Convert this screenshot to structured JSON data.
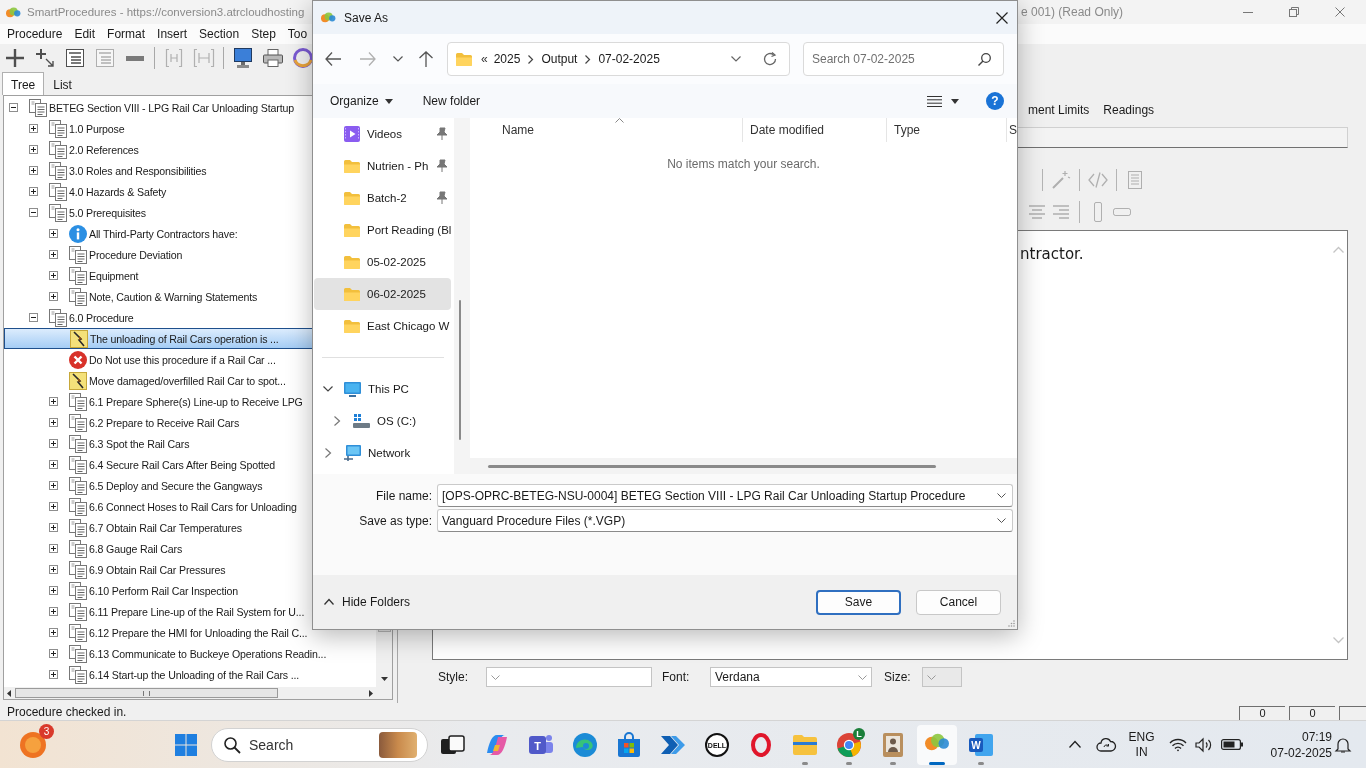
{
  "app_window": {
    "title": "SmartProcedures - https://conversion3.atrcloudhosting",
    "title_tail": "e 001) (Read Only)"
  },
  "menu": [
    "Procedure",
    "Edit",
    "Format",
    "Insert",
    "Section",
    "Step",
    "Too"
  ],
  "toolbar": [
    {
      "kind": "add",
      "disabled": false
    },
    {
      "kind": "add-child",
      "disabled": false
    },
    {
      "kind": "list",
      "disabled": false
    },
    {
      "kind": "list",
      "disabled": true
    },
    {
      "kind": "remove",
      "disabled": false
    },
    {
      "kind": "separator"
    },
    {
      "kind": "bracket",
      "disabled": true
    },
    {
      "kind": "bracket-wide",
      "disabled": true
    },
    {
      "kind": "separator"
    },
    {
      "kind": "monitor",
      "disabled": false
    },
    {
      "kind": "printer",
      "disabled": false
    },
    {
      "kind": "ring",
      "disabled": false
    }
  ],
  "tree": {
    "tabs": [
      {
        "label": "Tree",
        "selected": true
      },
      {
        "label": "List",
        "selected": false
      }
    ],
    "nodes": [
      {
        "label": "BETEG Section VIII - LPG Rail Car Unloading Startup",
        "kind": "section",
        "expanded": true,
        "selected": false,
        "children": [
          {
            "label": "1.0 Purpose",
            "kind": "section",
            "expanded": false,
            "selected": false
          },
          {
            "label": "2.0 References",
            "kind": "section",
            "expanded": false,
            "selected": false
          },
          {
            "label": "3.0 Roles and Responsibilities",
            "kind": "section",
            "expanded": false,
            "selected": false
          },
          {
            "label": "4.0 Hazards & Safety",
            "kind": "section",
            "expanded": false,
            "selected": false
          },
          {
            "label": "5.0 Prerequisites",
            "kind": "section",
            "expanded": true,
            "selected": false,
            "children": [
              {
                "label": "All Third-Party Contractors have:",
                "kind": "info",
                "expanded": false,
                "selected": false
              },
              {
                "label": "Procedure Deviation",
                "kind": "section",
                "expanded": false,
                "selected": false
              },
              {
                "label": "Equipment",
                "kind": "section",
                "expanded": false,
                "selected": false
              },
              {
                "label": "Note, Caution & Warning Statements",
                "kind": "section",
                "expanded": false,
                "selected": false
              }
            ]
          },
          {
            "label": "6.0 Procedure",
            "kind": "section",
            "expanded": true,
            "selected": false,
            "children": [
              {
                "label": "The unloading of Rail Cars operation is ...",
                "kind": "note",
                "selected": true
              },
              {
                "label": "Do Not use this procedure if a Rail Car ...",
                "kind": "stop",
                "selected": false
              },
              {
                "label": "Move damaged/overfilled Rail Car to spot...",
                "kind": "note",
                "selected": false
              },
              {
                "label": "6.1 Prepare Sphere(s) Line-up to Receive LPG",
                "kind": "section",
                "expanded": false,
                "selected": false
              },
              {
                "label": "6.2 Prepare to Receive Rail Cars",
                "kind": "section",
                "expanded": false,
                "selected": false
              },
              {
                "label": "6.3 Spot the Rail Cars",
                "kind": "section",
                "expanded": false,
                "selected": false
              },
              {
                "label": "6.4 Secure Rail Cars After Being Spotted",
                "kind": "section",
                "expanded": false,
                "selected": false
              },
              {
                "label": "6.5 Deploy and Secure the Gangways",
                "kind": "section",
                "expanded": false,
                "selected": false
              },
              {
                "label": "6.6 Connect Hoses to Rail Cars for Unloading",
                "kind": "section",
                "expanded": false,
                "selected": false
              },
              {
                "label": "6.7 Obtain Rail Car Temperatures",
                "kind": "section",
                "expanded": false,
                "selected": false
              },
              {
                "label": "6.8 Gauge Rail Cars",
                "kind": "section",
                "expanded": false,
                "selected": false
              },
              {
                "label": "6.9 Obtain Rail Car Pressures",
                "kind": "section",
                "expanded": false,
                "selected": false
              },
              {
                "label": "6.10 Perform Rail Car Inspection",
                "kind": "section",
                "expanded": false,
                "selected": false
              },
              {
                "label": "6.11 Prepare Line-up of the Rail System for U...",
                "kind": "section",
                "expanded": false,
                "selected": false
              },
              {
                "label": "6.12 Prepare the HMI for Unloading the Rail C...",
                "kind": "section",
                "expanded": false,
                "selected": false
              },
              {
                "label": "6.13 Communicate to Buckeye Operations Readin...",
                "kind": "section",
                "expanded": false,
                "selected": false
              },
              {
                "label": "6.14 Start-up the Unloading of the Rail Cars ...",
                "kind": "section",
                "expanded": false,
                "selected": false
              }
            ]
          }
        ]
      }
    ]
  },
  "detail": {
    "tabs": [
      {
        "label": "ment Limits",
        "selected": false
      },
      {
        "label": "Readings",
        "selected": false
      }
    ],
    "toolbar": [
      [
        {
          "kind": "separator"
        },
        {
          "kind": "wand",
          "disabled": true
        },
        {
          "kind": "separator"
        },
        {
          "kind": "code",
          "disabled": true
        },
        {
          "kind": "separator"
        },
        {
          "kind": "page",
          "disabled": true
        }
      ],
      [
        {
          "kind": "align-center",
          "disabled": true
        },
        {
          "kind": "align-right",
          "disabled": true
        },
        {
          "kind": "separator"
        },
        {
          "kind": "column",
          "disabled": true
        },
        {
          "kind": "field",
          "disabled": true
        }
      ]
    ],
    "editor_text": "ntractor.",
    "format_bar": [
      {
        "label": "Style:",
        "disabled": false
      },
      {
        "label": "Font:",
        "value": "Verdana",
        "disabled": false
      },
      {
        "label": "Size:",
        "disabled": true
      }
    ]
  },
  "status_bar": {
    "text": "Procedure checked in.",
    "panels": [
      "0",
      "0"
    ]
  },
  "dialog": {
    "title": "Save As",
    "nav_buttons": [
      {
        "kind": "back",
        "disabled": false
      },
      {
        "kind": "forward",
        "disabled": true
      },
      {
        "kind": "recent",
        "disabled": false
      },
      {
        "kind": "up",
        "disabled": false
      }
    ],
    "address": {
      "overflow": "«",
      "segments": [
        "2025",
        "Output",
        "07-02-2025"
      ]
    },
    "search": {
      "placeholder": "Search 07-02-2025"
    },
    "commands": [
      {
        "label": "Organize",
        "kind": "menu"
      },
      {
        "label": "New folder",
        "kind": "button"
      }
    ],
    "help": "?",
    "nav": {
      "quick_access": [
        {
          "label": "Videos",
          "kind": "videos",
          "pinned": true,
          "selected": false
        },
        {
          "label": "Nutrien - Ph",
          "kind": "folder",
          "pinned": true,
          "selected": false
        },
        {
          "label": "Batch-2",
          "kind": "folder",
          "pinned": true,
          "selected": false
        },
        {
          "label": "Port Reading (Bl",
          "kind": "folder",
          "pinned": false,
          "selected": false
        },
        {
          "label": "05-02-2025",
          "kind": "folder",
          "pinned": false,
          "selected": false
        },
        {
          "label": "06-02-2025",
          "kind": "folder",
          "pinned": false,
          "selected": true
        },
        {
          "label": "East Chicago W",
          "kind": "folder",
          "pinned": false,
          "selected": false
        }
      ],
      "places": [
        {
          "label": "This PC",
          "kind": "pc",
          "expanded": true,
          "selected": false,
          "children": [
            {
              "label": "OS (C:)",
              "kind": "drive",
              "expanded": false,
              "selected": false
            }
          ]
        },
        {
          "label": "Network",
          "kind": "network",
          "expanded": false,
          "selected": false
        }
      ]
    },
    "columns": [
      {
        "label": "Name",
        "sorted": true
      },
      {
        "label": "Date modified",
        "sorted": false
      },
      {
        "label": "Type",
        "sorted": false
      },
      {
        "label": "S",
        "sorted": false
      }
    ],
    "empty_message": "No items match your search.",
    "file_name": {
      "label": "File name:",
      "value": "[OPS-OPRC-BETEG-NSU-0004] BETEG Section VIII - LPG Rail Car Unloading Startup Procedure"
    },
    "save_as_type": {
      "label": "Save as type:",
      "value": "Vanguard Procedure Files (*.VGP)"
    },
    "hide_folders": "Hide Folders",
    "save_button": {
      "label": "Save",
      "default": true
    },
    "cancel_button": {
      "label": "Cancel",
      "default": false
    }
  },
  "taskbar": {
    "weather_badge": "3",
    "search": {
      "placeholder": "Search"
    },
    "apps": [
      {
        "kind": "taskview",
        "running": false,
        "active": false
      },
      {
        "kind": "copilot",
        "running": false,
        "active": false
      },
      {
        "kind": "teams",
        "label": "T",
        "running": false,
        "active": false
      },
      {
        "kind": "edge",
        "running": false,
        "active": false
      },
      {
        "kind": "store",
        "running": false,
        "active": false
      },
      {
        "kind": "automate",
        "running": false,
        "active": false
      },
      {
        "kind": "dell",
        "label": "DELL",
        "running": false,
        "active": false
      },
      {
        "kind": "opera",
        "running": false,
        "active": false
      },
      {
        "kind": "explorer",
        "running": true,
        "active": false
      },
      {
        "kind": "chrome",
        "badge": "L",
        "running": true,
        "active": false
      },
      {
        "kind": "portrait",
        "running": true,
        "active": false
      },
      {
        "kind": "procedures",
        "running": true,
        "active": true
      },
      {
        "kind": "word",
        "label": "W",
        "running": true,
        "active": false
      }
    ],
    "tray": {
      "language": "ENG",
      "region": "IN",
      "time": "07:19",
      "date": "07-02-2025"
    }
  }
}
